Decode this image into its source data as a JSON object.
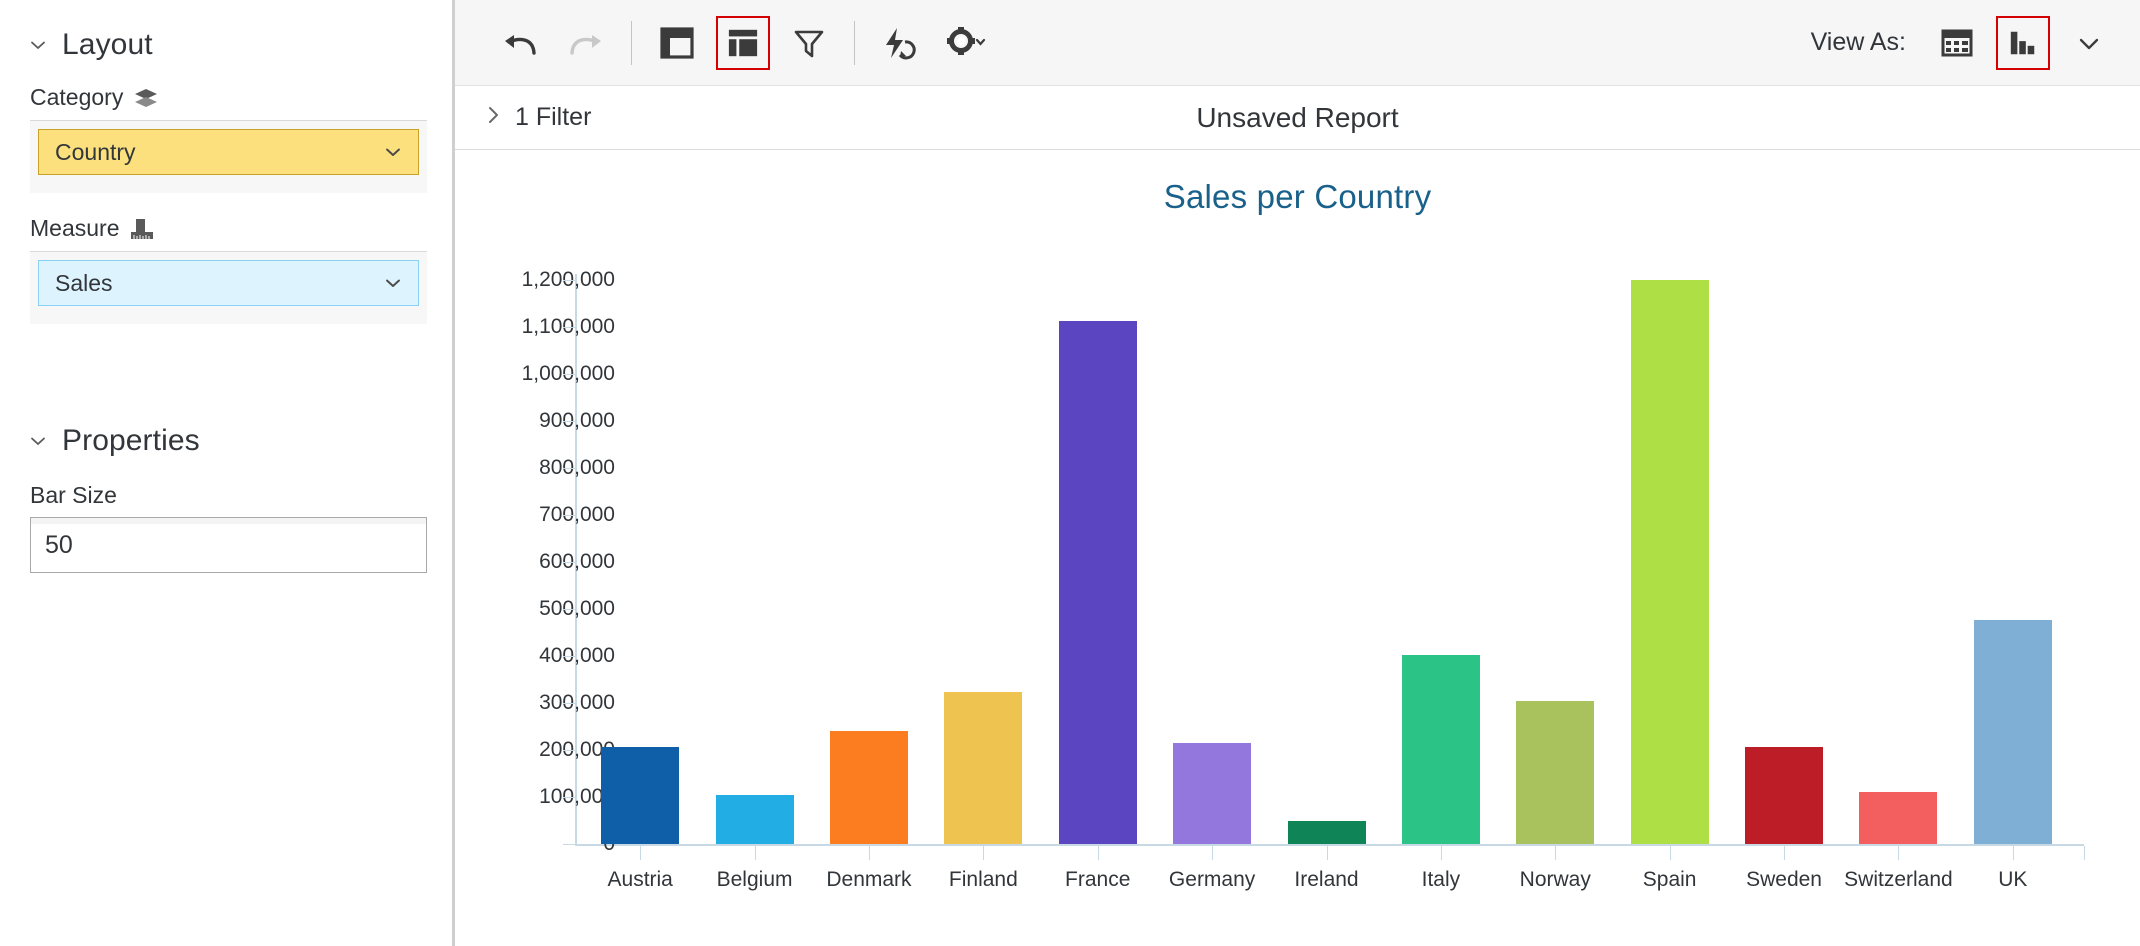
{
  "sidebar": {
    "layout": {
      "title": "Layout",
      "category_label": "Category",
      "category_icon": "layers-icon",
      "category_value": "Country",
      "measure_label": "Measure",
      "measure_icon": "ruler-icon",
      "measure_value": "Sales"
    },
    "properties": {
      "title": "Properties",
      "bar_size_label": "Bar Size",
      "bar_size_value": "50"
    }
  },
  "toolbar": {
    "undo": "undo-icon",
    "redo": "redo-icon",
    "panel": "panel-layout-icon",
    "split_panel": "split-layout-icon",
    "filter": "filter-funnel-icon",
    "flash_refresh": "flash-refresh-icon",
    "settings": "gear-dropdown-icon",
    "view_as_label": "View As:",
    "view_table": "table-view-icon",
    "view_chart": "bar-chart-view-icon",
    "view_more": "chevron-down-icon"
  },
  "filterbar": {
    "toggle_icon": "chevron-right-icon",
    "filter_text": "1 Filter",
    "report_title": "Unsaved Report"
  },
  "chart_data": {
    "type": "bar",
    "title": "Sales per Country",
    "xlabel": "",
    "ylabel": "",
    "ylim": [
      0,
      1200000
    ],
    "grid": false,
    "legend": null,
    "ytick_labels": [
      "1,200,000",
      "1,100,000",
      "1,000,000",
      "900,000",
      "800,000",
      "700,000",
      "600,000",
      "500,000",
      "400,000",
      "300,000",
      "200,000",
      "100,000",
      "0"
    ],
    "ytick_values": [
      1200000,
      1100000,
      1000000,
      900000,
      800000,
      700000,
      600000,
      500000,
      400000,
      300000,
      200000,
      100000,
      0
    ],
    "categories": [
      "Austria",
      "Belgium",
      "Denmark",
      "Finland",
      "France",
      "Germany",
      "Ireland",
      "Italy",
      "Norway",
      "Spain",
      "Sweden",
      "Switzerland",
      "UK"
    ],
    "values": [
      206000,
      104000,
      241000,
      323000,
      1112000,
      214000,
      49000,
      402000,
      304000,
      1216000,
      206000,
      110000,
      476000
    ],
    "colors": [
      "#0f5ea8",
      "#22ade4",
      "#fb7d20",
      "#efc34f",
      "#5b45c0",
      "#9377dd",
      "#0e8457",
      "#2bc486",
      "#a9c25d",
      "#aee046",
      "#bc1d27",
      "#f35e5e",
      "#7fafd4"
    ]
  },
  "colors": {
    "accent": "#19618a",
    "selected_outline": "#d50000",
    "category_field_bg": "#fbe07d",
    "measure_field_bg": "#ddf3fd",
    "axis": "#c8d9e6"
  }
}
